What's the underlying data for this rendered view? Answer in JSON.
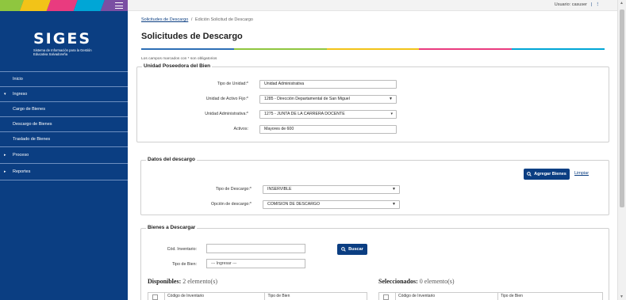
{
  "sidebar": {
    "logo_title": "SIGES",
    "logo_subtitle": "Sistema de Información para la Gestión Educativa Salvadoreña",
    "stripe_colors": [
      "#8fc63f",
      "#f2c318",
      "#e93b7f",
      "#00a6d6",
      "#7a4fa3"
    ],
    "items": [
      {
        "label": "Inicio",
        "caret": ""
      },
      {
        "label": "Ingreso",
        "caret": "▾"
      },
      {
        "label": "Cargo de Bienes",
        "caret": ""
      },
      {
        "label": "Descargo de Bienes",
        "caret": ""
      },
      {
        "label": "Traslado de Bienes",
        "caret": ""
      },
      {
        "label": "Proceso",
        "caret": "▸"
      },
      {
        "label": "Reportes",
        "caret": "▸"
      }
    ]
  },
  "topbar": {
    "user_label": "Usuario: casuser",
    "separator": "|",
    "menu_glyph": "⋮"
  },
  "breadcrumb": {
    "parent": "Solicitudes de Descargo",
    "separator": "/",
    "current": "Edición Solicitud de Descargo"
  },
  "page": {
    "title": "Solicitudes de Descargo",
    "required_note": "Los campos marcados con * son obligatorios",
    "bar_colors": [
      "#2d6fb6",
      "#8fc63f",
      "#f2c318",
      "#e93b7f",
      "#00a6d6"
    ]
  },
  "unidad": {
    "legend": "Unidad Poseedora del Bien",
    "tipo_unidad_label": "Tipo de Unidad:*",
    "tipo_unidad_value": "Unidad Administrativa",
    "unidad_activo_fijo_label": "Unidad de Activo Fijo:*",
    "unidad_activo_fijo_value": "1285 - Dirección Departamental de San Miguel",
    "unidad_admin_label": "Unidad Administrativa:*",
    "unidad_admin_value": "1275 - JUNTA DE LA CARRERA DOCENTE",
    "activos_label": "Activos:",
    "activos_value": "Mayores de 600"
  },
  "descargo": {
    "legend": "Datos del descargo",
    "agregar_button": "Agregar Bienes",
    "limpiar_link": "Limpiar",
    "tipo_descargo_label": "Tipo de Descargo:*",
    "tipo_descargo_value": "INSERVIBLE",
    "opcion_descargo_label": "Opción de descargo:*",
    "opcion_descargo_value": "COMISION DE DESCARGO"
  },
  "bienes": {
    "legend": "Bienes a Descargar",
    "cod_inventario_label": "Cód. Inventario:",
    "cod_inventario_value": "",
    "tipo_bien_label": "Tipo de Bien:",
    "tipo_bien_value": "--- Ingresar ---",
    "buscar_button": "Buscar",
    "disponibles_title": "Disponibles:",
    "disponibles_count": "2 elemento(s)",
    "seleccionados_title": "Seleccionados:",
    "seleccionados_count": "0 elemento(s)",
    "columns": [
      "Código de Inventario",
      "Tipo de Bien"
    ]
  }
}
